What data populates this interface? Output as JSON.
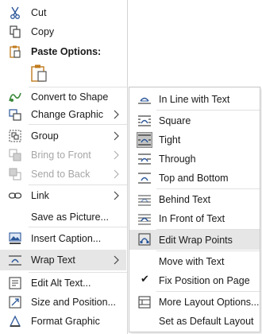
{
  "menu": {
    "cut": "Cut",
    "copy": "Copy",
    "paste_options": "Paste Options:",
    "convert_to_shape": "Convert to Shape",
    "change_graphic": "Change Graphic",
    "group": "Group",
    "bring_to_front": "Bring to Front",
    "send_to_back": "Send to Back",
    "link": "Link",
    "save_as_picture": "Save as Picture...",
    "insert_caption": "Insert Caption...",
    "wrap_text": "Wrap Text",
    "edit_alt_text": "Edit Alt Text...",
    "size_and_position": "Size and Position...",
    "format_graphic": "Format Graphic"
  },
  "submenu": {
    "in_line_with_text": "In Line with Text",
    "square": "Square",
    "tight": "Tight",
    "through": "Through",
    "top_and_bottom": "Top and Bottom",
    "behind_text": "Behind Text",
    "in_front_of_text": "In Front of Text",
    "edit_wrap_points": "Edit Wrap Points",
    "move_with_text": "Move with Text",
    "fix_position_on_page": "Fix Position on Page",
    "more_layout_options": "More Layout Options...",
    "set_as_default_layout": "Set as Default Layout"
  },
  "colors": {
    "highlight": "#e6e6e6",
    "disabled": "#a6a6a6",
    "icon_blue": "#2b579a",
    "icon_dark": "#444444",
    "paste_orange": "#c07a1c",
    "graphic_green": "#3a8a3a"
  }
}
